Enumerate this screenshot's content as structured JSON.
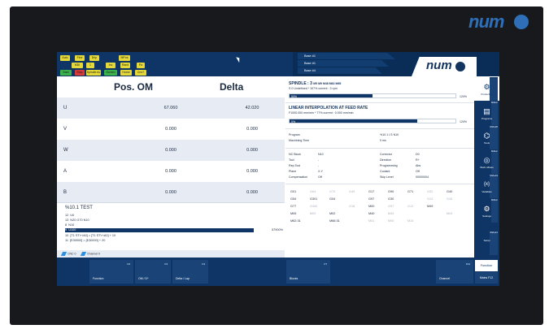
{
  "brand": "num",
  "machine_buttons": [
    {
      "label": "Auto",
      "color": "#e5d93a"
    },
    {
      "label": "Fine",
      "color": "#e5d93a"
    },
    {
      "label": "Drip",
      "color": "#e5d93a"
    },
    {
      "label": "MPos",
      "color": "#e5d93a"
    },
    {
      "label": "MDI",
      "color": "#e5d93a"
    },
    {
      "label": "1",
      "color": "#e5d93a"
    },
    {
      "label": "Inc",
      "color": "#e5d93a"
    },
    {
      "label": "Rand",
      "color": "#e5d93a"
    },
    {
      "label": "Pa",
      "color": "#e5d93a"
    },
    {
      "label": "Start",
      "color": "#3bb34a"
    },
    {
      "label": "Stop",
      "color": "#d93a3a"
    },
    {
      "label": "Spindle Ac",
      "color": "#e5d93a"
    },
    {
      "label": "Screen",
      "color": "#3bb34a"
    },
    {
      "label": "Home",
      "color": "#e5d93a"
    },
    {
      "label": "Cnx?",
      "color": "#e5d93a"
    }
  ],
  "program_tabs": [
    "Base #1",
    "Base #1",
    "Base #4"
  ],
  "position": {
    "title_pos": "Pos. OM",
    "title_delta": "Delta",
    "axes": [
      {
        "name": "U",
        "pos": "67.060",
        "delta": "42.020"
      },
      {
        "name": "V",
        "pos": "0.000",
        "delta": "0.000"
      },
      {
        "name": "W",
        "pos": "0.000",
        "delta": "0.000"
      },
      {
        "name": "A",
        "pos": "0.000",
        "delta": "0.000"
      },
      {
        "name": "B",
        "pos": "0.000",
        "delta": "0.000"
      }
    ]
  },
  "program": {
    "title": "%10.1 TEST",
    "lines": [
      {
        "n": "12",
        "text": "U0"
      },
      {
        "n": "13",
        "text": "N20 G70 N10"
      },
      {
        "n": "8",
        "text": "N10"
      },
      {
        "n": "9",
        "text": "U100",
        "pct": "57900%"
      },
      {
        "n": "10",
        "text": "[T1 ST\\+\\A0] = [T1 ST\\+\\A0] + 10"
      },
      {
        "n": "11",
        "text": "[E30000] = [E30000] + 20"
      }
    ]
  },
  "channels": [
    "CNC 0",
    "Channel 0"
  ],
  "spindle": {
    "title": "SPINDLE : 3",
    "title_codes": "M5 M9 M48 M62 M65",
    "sub": "S 0 Undefined * 107% current : 3 rpm",
    "bar_left": "50%",
    "bar_right": "120%",
    "fill": 0.5
  },
  "interp": {
    "title": "LINEAR INTERPOLATION AT FEED RATE",
    "sub": "F1000.000 mm/min * 77% current : 0.000 mm/min",
    "bar_left": "0%",
    "bar_right": "120%",
    "fill": 0.77
  },
  "prog_info": {
    "program_label": "Program",
    "program_val": "%10.1 I.S N10",
    "mtime_label": "Machining Time",
    "mtime_val": "0 ms"
  },
  "block_info": [
    {
      "label": "NC Block",
      "val": "N10"
    },
    {
      "label": "Tool",
      "val": "-"
    },
    {
      "label": "Rep.Tool",
      "val": "-"
    },
    {
      "label": "Plane",
      "val": "X-Y"
    },
    {
      "label": "Compensation",
      "val": "Off"
    }
  ],
  "corr_info": [
    {
      "label": "Corrector",
      "val": "D0"
    },
    {
      "label": "Direction",
      "val": "R+"
    },
    {
      "label": "Programming",
      "val": "Abs"
    },
    {
      "label": "Coolant",
      "val": "Off"
    },
    {
      "label": "Skip Level",
      "val": "00000004"
    }
  ],
  "gcodes": [
    [
      {
        "c": "G01",
        "d": false
      },
      {
        "c": "G64",
        "d": true
      },
      {
        "c": "G70",
        "d": true
      },
      {
        "c": "G49",
        "d": true
      },
      {
        "c": "G17",
        "d": false
      },
      {
        "c": "G90",
        "d": false
      },
      {
        "c": "G71",
        "d": false
      },
      {
        "c": "G52",
        "d": true
      },
      {
        "c": "G40",
        "d": false
      }
    ],
    [
      {
        "c": "G54",
        "d": false
      },
      {
        "c": "G301",
        "d": false
      },
      {
        "c": "G04",
        "d": false
      },
      {
        "c": "",
        "d": true
      },
      {
        "c": "G97",
        "d": false
      },
      {
        "c": "G30",
        "d": false
      },
      {
        "c": "",
        "d": true
      },
      {
        "c": "G24",
        "d": true
      },
      {
        "c": "G26",
        "d": true
      }
    ],
    [
      {
        "c": "G77",
        "d": false
      },
      {
        "c": "G400",
        "d": true
      },
      {
        "c": "",
        "d": true
      },
      {
        "c": "G18",
        "d": true
      },
      {
        "c": "M00",
        "d": false
      },
      {
        "c": "G57",
        "d": true
      },
      {
        "c": "G12",
        "d": true
      },
      {
        "c": "M49",
        "d": false
      },
      {
        "c": "",
        "d": true
      }
    ],
    [
      {
        "c": "M05",
        "d": false
      },
      {
        "c": "M09",
        "d": true
      },
      {
        "c": "M02",
        "d": false
      },
      {
        "c": "",
        "d": true
      },
      {
        "c": "M40",
        "d": false
      },
      {
        "c": "M49",
        "d": true
      },
      {
        "c": "",
        "d": true
      },
      {
        "c": "",
        "d": true
      },
      {
        "c": "M04",
        "d": true
      }
    ],
    [
      {
        "c": "M62:31",
        "d": false
      },
      {
        "c": "",
        "d": true
      },
      {
        "c": "M66:31",
        "d": false
      },
      {
        "c": "",
        "d": true
      },
      {
        "c": "M01",
        "d": true
      },
      {
        "c": "M05",
        "d": true
      },
      {
        "c": "M15",
        "d": true
      },
      {
        "c": "",
        "d": true
      },
      {
        "c": "",
        "d": true
      }
    ]
  ],
  "right_menu": [
    {
      "key": "Shift+F8",
      "label": "Production",
      "icon": "⚙"
    },
    {
      "key": "Shift+F",
      "label": "Programs",
      "icon": "▤"
    },
    {
      "key": "Shift+F6",
      "label": "Tools",
      "icon": "⌬"
    },
    {
      "key": "Shift+F",
      "label": "Work offsets",
      "icon": "◎"
    },
    {
      "key": "Shift+F3",
      "label": "Variables",
      "icon": "{x}"
    },
    {
      "key": "Shift+F",
      "label": "Settings",
      "icon": "⚙"
    },
    {
      "key": "Shift+F1",
      "label": "Setup",
      "icon": ""
    }
  ],
  "softkeys": [
    {
      "key": "F2",
      "label": "Function"
    },
    {
      "key": "F3",
      "label": "OM / D*"
    },
    {
      "key": "F4",
      "label": "Delta / Lap"
    },
    {
      "key": "F7",
      "label": "Blocks"
    },
    {
      "key": "F11",
      "label": "Channel"
    }
  ],
  "function_btn": "Function",
  "main_btn": "Mains F12"
}
